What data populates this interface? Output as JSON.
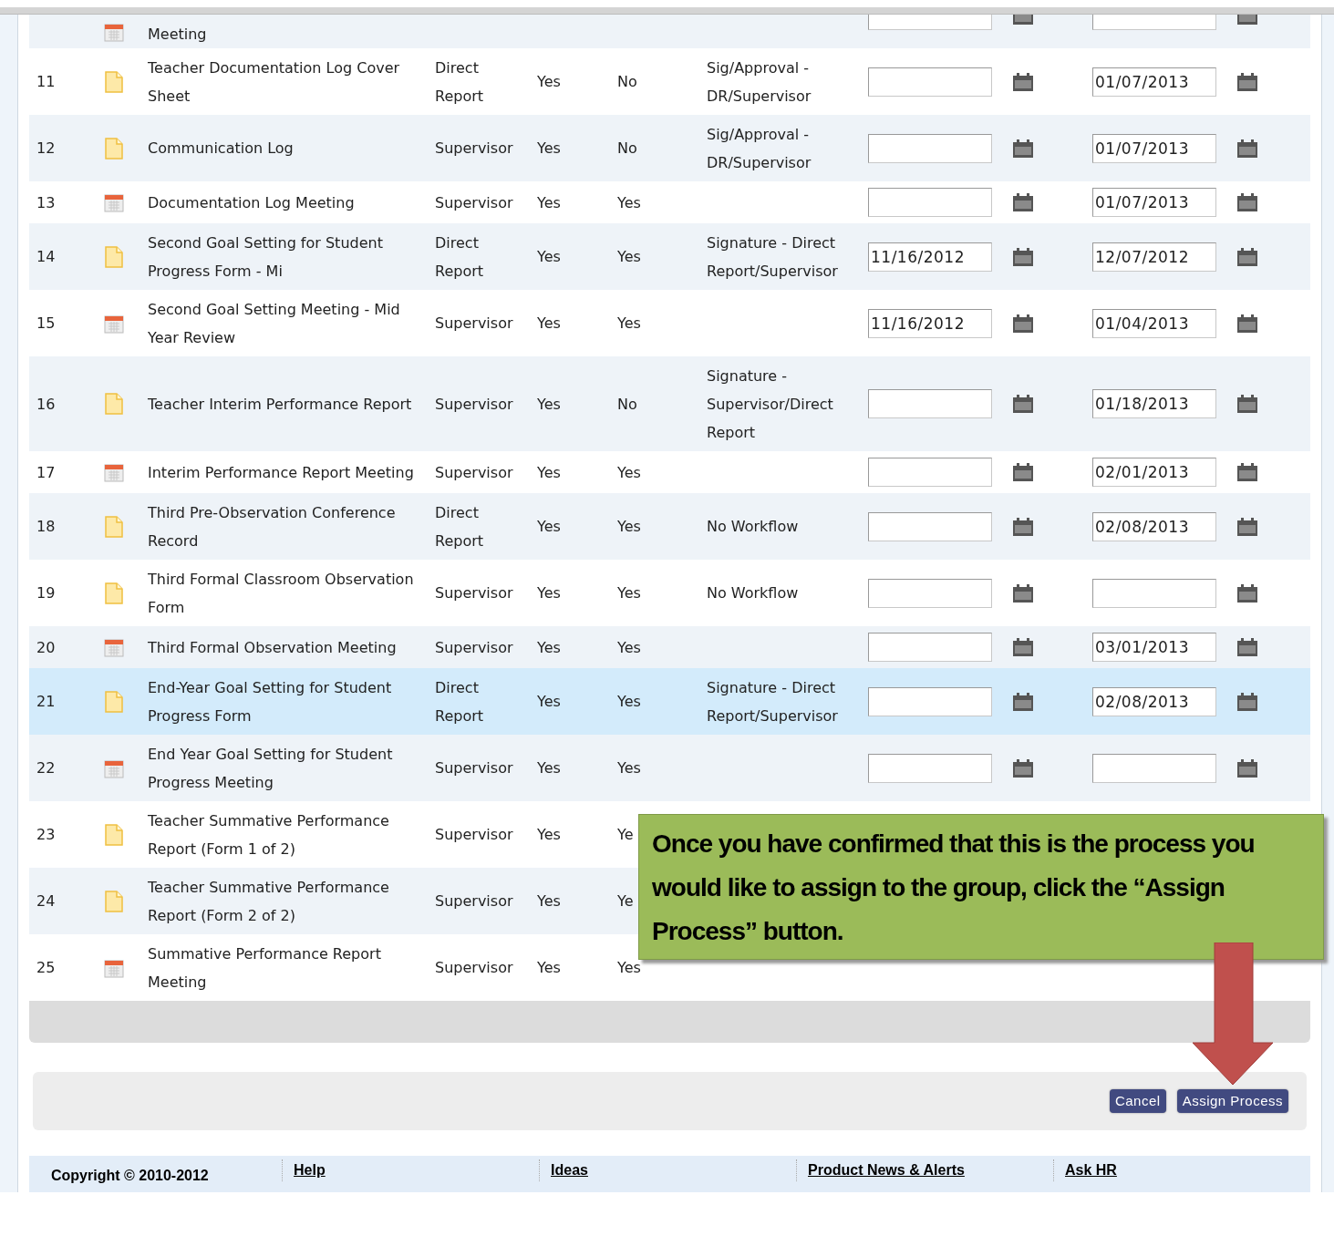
{
  "rows": [
    {
      "kind": "meeting",
      "name": "Meeting",
      "selected": false,
      "date_fields": [
        {
          "kind": "date"
        },
        {
          "kind": "date"
        }
      ]
    },
    {
      "number": "11",
      "kind": "document",
      "name": "Teacher Documentation Log Cover Sheet",
      "column_4": "Direct Report",
      "column_5": "Yes",
      "column_6": "No",
      "column_7": "Sig/Approval - DR/Supervisor",
      "selected": false,
      "date_fields": [
        {
          "kind": "date"
        },
        {
          "kind": "date",
          "value": "01/07/2013"
        }
      ]
    },
    {
      "number": "12",
      "kind": "document",
      "name": "Communication Log",
      "column_4": "Supervisor",
      "column_5": "Yes",
      "column_6": "No",
      "column_7": "Sig/Approval - DR/Supervisor",
      "selected": false,
      "date_fields": [
        {
          "kind": "date"
        },
        {
          "kind": "date",
          "value": "01/07/2013"
        }
      ]
    },
    {
      "number": "13",
      "kind": "meeting",
      "name": "Documentation Log Meeting",
      "column_4": "Supervisor",
      "column_5": "Yes",
      "column_6": "Yes",
      "selected": false,
      "date_fields": [
        {
          "kind": "date"
        },
        {
          "kind": "date",
          "value": "01/07/2013"
        }
      ]
    },
    {
      "number": "14",
      "kind": "document",
      "name": "Second Goal Setting for Student Progress Form - Mi",
      "column_4": "Direct Report",
      "column_5": "Yes",
      "column_6": "Yes",
      "column_7": "Signature - Direct Report/Supervisor",
      "selected": false,
      "date_fields": [
        {
          "kind": "date",
          "value": "11/16/2012"
        },
        {
          "kind": "date",
          "value": "12/07/2012"
        }
      ]
    },
    {
      "number": "15",
      "kind": "meeting",
      "name": "Second Goal Setting Meeting - Mid Year Review",
      "column_4": "Supervisor",
      "column_5": "Yes",
      "column_6": "Yes",
      "selected": false,
      "date_fields": [
        {
          "kind": "date",
          "value": "11/16/2012"
        },
        {
          "kind": "date",
          "value": "01/04/2013"
        }
      ]
    },
    {
      "number": "16",
      "kind": "document",
      "name": "Teacher Interim Performance Report",
      "column_4": "Supervisor",
      "column_5": "Yes",
      "column_6": "No",
      "column_7": "Signature - Supervisor/Direct Report",
      "selected": false,
      "date_fields": [
        {
          "kind": "date"
        },
        {
          "kind": "date",
          "value": "01/18/2013"
        }
      ]
    },
    {
      "number": "17",
      "kind": "meeting",
      "name": "Interim Performance Report Meeting",
      "column_4": "Supervisor",
      "column_5": "Yes",
      "column_6": "Yes",
      "selected": false,
      "date_fields": [
        {
          "kind": "date"
        },
        {
          "kind": "date",
          "value": "02/01/2013"
        }
      ]
    },
    {
      "number": "18",
      "kind": "document",
      "name": "Third Pre-Observation Conference Record",
      "column_4": "Direct Report",
      "column_5": "Yes",
      "column_6": "Yes",
      "column_7": "No Workflow",
      "selected": false,
      "date_fields": [
        {
          "kind": "date"
        },
        {
          "kind": "date",
          "value": "02/08/2013"
        }
      ]
    },
    {
      "number": "19",
      "kind": "document",
      "name": "Third Formal Classroom Observation Form",
      "column_4": "Supervisor",
      "column_5": "Yes",
      "column_6": "Yes",
      "column_7": "No Workflow",
      "selected": false,
      "date_fields": [
        {
          "kind": "date"
        },
        {
          "kind": "date"
        }
      ]
    },
    {
      "number": "20",
      "kind": "meeting",
      "name": "Third Formal Observation Meeting",
      "column_4": "Supervisor",
      "column_5": "Yes",
      "column_6": "Yes",
      "selected": false,
      "date_fields": [
        {
          "kind": "date"
        },
        {
          "kind": "date",
          "value": "03/01/2013"
        }
      ]
    },
    {
      "number": "21",
      "kind": "document",
      "name": "End-Year Goal Setting for Student Progress Form",
      "column_4": "Direct Report",
      "column_5": "Yes",
      "column_6": "Yes",
      "column_7": "Signature - Direct Report/Supervisor",
      "selected": true,
      "date_fields": [
        {
          "kind": "date"
        },
        {
          "kind": "date",
          "value": "02/08/2013"
        }
      ]
    },
    {
      "number": "22",
      "kind": "meeting",
      "name": "End Year Goal Setting for Student Progress Meeting",
      "column_4": "Supervisor",
      "column_5": "Yes",
      "column_6": "Yes",
      "selected": false,
      "date_fields": [
        {
          "kind": "date"
        },
        {
          "kind": "date"
        }
      ]
    },
    {
      "number": "23",
      "kind": "document",
      "name": "Teacher Summative Performance Report (Form 1 of 2)",
      "column_4": "Supervisor",
      "column_5": "Yes",
      "column_6": "Ye",
      "selected": false
    },
    {
      "number": "24",
      "kind": "document",
      "name": "Teacher Summative Performance Report (Form 2 of 2)",
      "column_4": "Supervisor",
      "column_5": "Yes",
      "column_6": "Ye",
      "selected": false
    },
    {
      "number": "25",
      "kind": "meeting",
      "name": "Summative Performance Report Meeting",
      "column_4": "Supervisor",
      "column_5": "Yes",
      "column_6": "Yes",
      "selected": false
    }
  ],
  "buttons": [
    "Cancel",
    "Assign Process"
  ],
  "footer": {
    "copyright": "Copyright © 2010-2012",
    "links": [
      "Help",
      "Ideas",
      "Product News & Alerts",
      "Ask HR"
    ]
  },
  "callout": {
    "text": "Once you have confirmed that this is the process you would like to assign to the group, click the “Assign Process” button."
  }
}
